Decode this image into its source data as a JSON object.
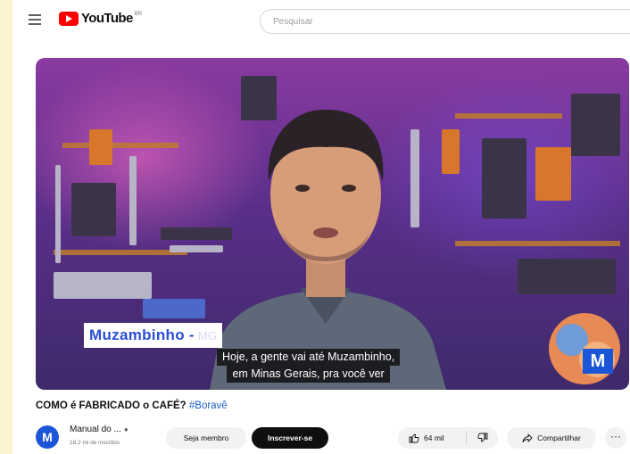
{
  "header": {
    "logo_text": "YouTube",
    "region": "BR",
    "search_placeholder": "Pesquisar"
  },
  "video": {
    "lower_third_city": "Muzambinho -",
    "lower_third_state": "MG",
    "caption_line1": "Hoje, a gente vai até Muzambinho,",
    "caption_line2": "em Minas Gerais, pra você ver",
    "channel_badge": "M"
  },
  "details": {
    "title": "COMO é FABRICADO o CAFÉ?",
    "hashtag": "#Boravê",
    "channel_name": "Manual do ...",
    "subscribers": "18,2 mi de inscritos",
    "avatar_letter": "M"
  },
  "actions": {
    "member_label": "Seja membro",
    "subscribe_label": "Inscrever-se",
    "likes": "64 mil",
    "share_label": "Compartilhar",
    "more_label": "···"
  },
  "colors": {
    "brand_red": "#ff0000",
    "channel_blue": "#1c56d8",
    "hashtag_blue": "#1a5fc2"
  }
}
